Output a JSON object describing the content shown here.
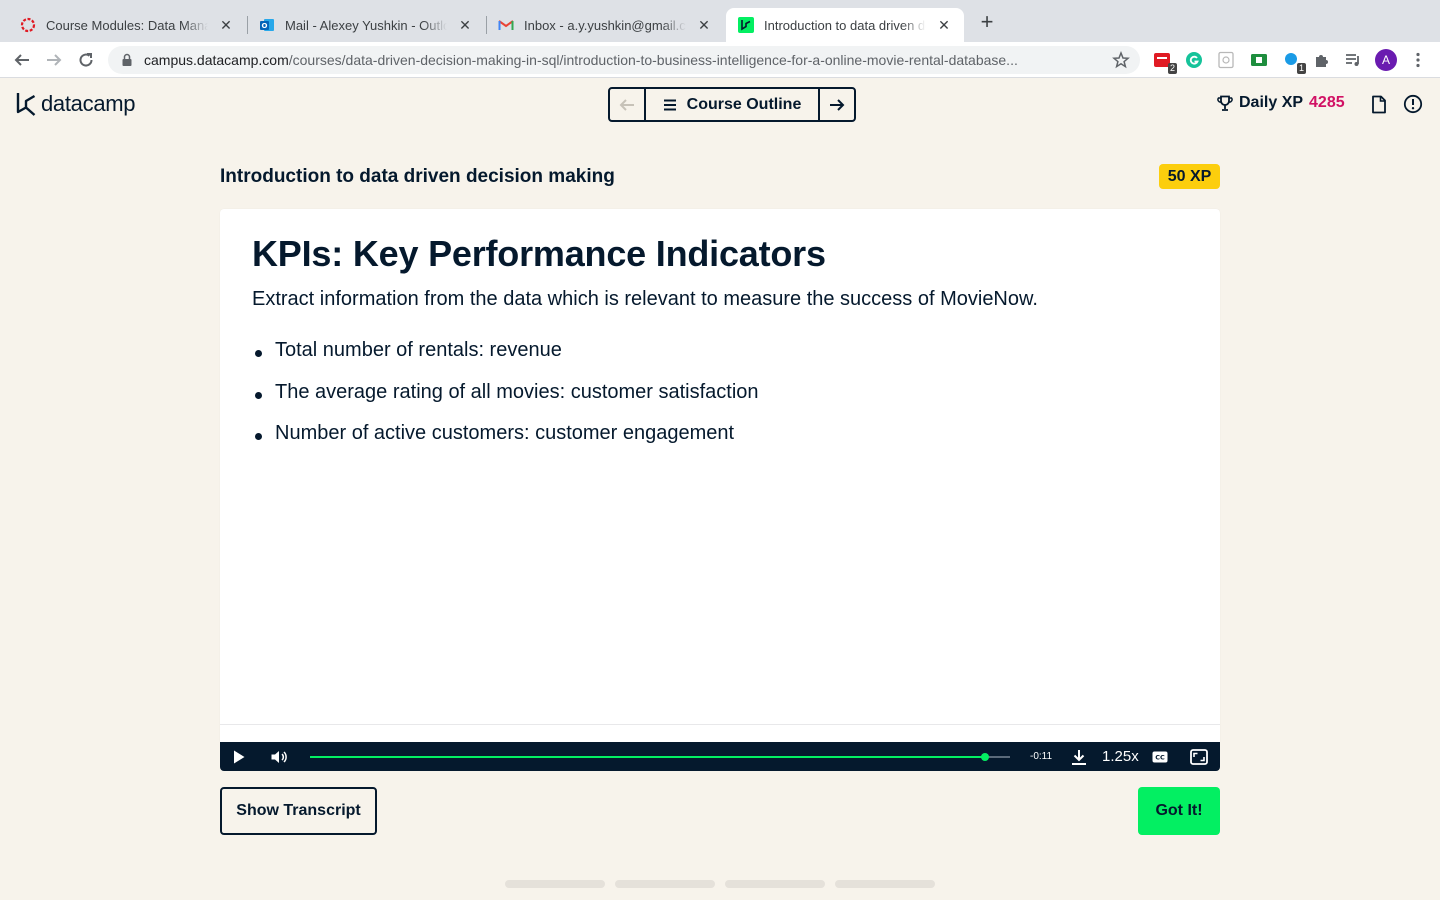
{
  "browser": {
    "tabs": [
      {
        "title": "Course Modules: Data Manage",
        "icon": "lms-ring-icon"
      },
      {
        "title": "Mail - Alexey Yushkin - Outlook",
        "icon": "outlook-icon"
      },
      {
        "title": "Inbox - a.y.yushkin@gmail.com",
        "icon": "gmail-icon"
      },
      {
        "title": "Introduction to data driven dec",
        "icon": "datacamp-icon",
        "active": true
      }
    ],
    "url_host": "campus.datacamp.com",
    "url_path": "/courses/data-driven-decision-making-in-sql/introduction-to-business-intelligence-for-a-online-movie-rental-database...",
    "extension_badges": [
      "2",
      "1"
    ],
    "avatar_letter": "A"
  },
  "header": {
    "logo_text": "datacamp",
    "course_outline_label": "Course Outline",
    "daily_xp_label": "Daily XP",
    "daily_xp_value": "4285"
  },
  "exercise": {
    "title": "Introduction to data driven decision making",
    "xp_badge": "50 XP"
  },
  "slide": {
    "heading": "KPIs: Key Performance Indicators",
    "lead": "Extract information from the data which is relevant to measure the success of MovieNow.",
    "bullets": [
      "Total number of rentals: revenue",
      "The average rating of all movies: customer satisfaction",
      "Number of active customers: customer engagement"
    ]
  },
  "player": {
    "progress": 0.964,
    "time_remaining": "-0:11",
    "speed": "1.25x"
  },
  "buttons": {
    "show_transcript": "Show Transcript",
    "got_it": "Got It!"
  },
  "pager_count": 4,
  "colors": {
    "brand_green": "#03ef62",
    "navy": "#05192d",
    "xp_magenta": "#d11164",
    "xp_badge_yellow": "#fcce0d",
    "page_bg": "#f7f3eb"
  }
}
